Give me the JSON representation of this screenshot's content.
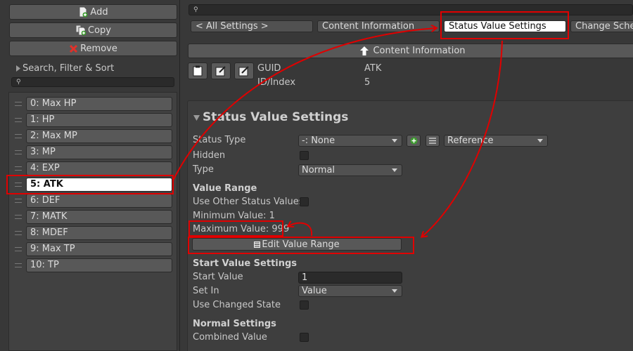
{
  "left_panel": {
    "add_label": "Add",
    "copy_label": "Copy",
    "remove_label": "Remove",
    "search_label": "Search, Filter & Sort",
    "search_placeholder": "",
    "items": [
      {
        "label": "0: Max HP",
        "selected": false
      },
      {
        "label": "1: HP",
        "selected": false
      },
      {
        "label": "2: Max MP",
        "selected": false
      },
      {
        "label": "3: MP",
        "selected": false
      },
      {
        "label": "4: EXP",
        "selected": false
      },
      {
        "label": "5: ATK",
        "selected": true
      },
      {
        "label": "6: DEF",
        "selected": false
      },
      {
        "label": "7: MATK",
        "selected": false
      },
      {
        "label": "8: MDEF",
        "selected": false
      },
      {
        "label": "9: Max TP",
        "selected": false
      },
      {
        "label": "10: TP",
        "selected": false
      }
    ]
  },
  "right_panel": {
    "search_placeholder": "",
    "nav": {
      "all_settings": "< All Settings >",
      "content_information": "Content Information",
      "status_value_settings": "Status Value Settings",
      "change_scheme": "Change Schem"
    },
    "content_info_bar": "Content Information",
    "guid_label": "GUID",
    "guid_value": "ATK",
    "id_label": "ID/Index",
    "id_value": "5",
    "section_title": "Status Value Settings",
    "status_type_label": "Status Type",
    "status_type_value": "-: None",
    "reference_value": "Reference",
    "hidden_label": "Hidden",
    "type_label": "Type",
    "type_value": "Normal",
    "value_range_header": "Value Range",
    "use_other_label": "Use Other Status Values",
    "minimum_value": "Minimum Value: 1",
    "maximum_value": "Maximum Value: 999",
    "edit_value_range": "Edit Value Range",
    "start_value_header": "Start Value Settings",
    "start_value_label": "Start Value",
    "start_value_value": "1",
    "set_in_label": "Set In",
    "set_in_value": "Value",
    "use_changed_state_label": "Use Changed State",
    "normal_settings_header": "Normal Settings",
    "combined_value_label": "Combined Value"
  },
  "colors": {
    "annotation_red": "#e00000",
    "panel_bg": "#383838",
    "selected_bg": "#ffffff"
  },
  "icons": [
    "add-file-icon",
    "copy-file-icon",
    "remove-x-icon",
    "search-icon",
    "foldout-arrow-icon",
    "up-arrow-icon",
    "clipboard-icon",
    "edit-icon",
    "plus-icon",
    "list-icon"
  ]
}
